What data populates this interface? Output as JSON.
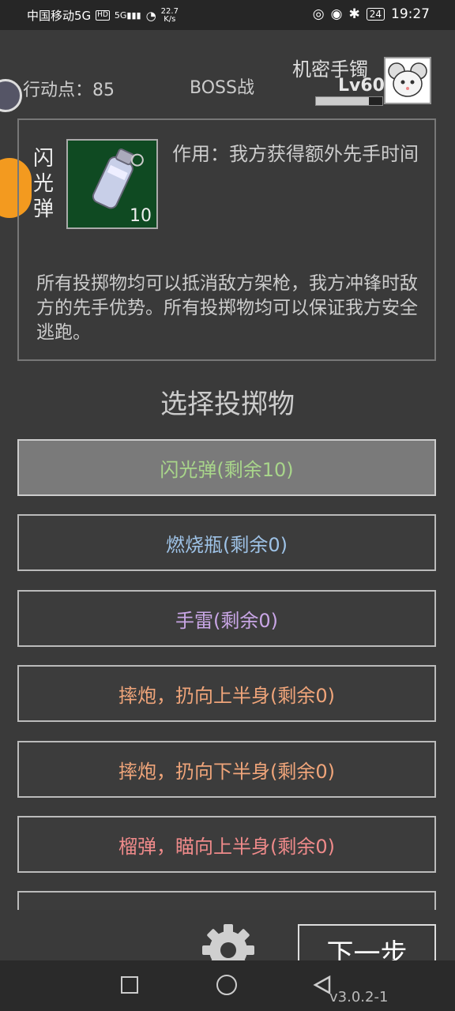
{
  "status_bar": {
    "carrier": "中国移动5G",
    "hd": "HD",
    "signal": "5G",
    "speed_top": "22.7",
    "speed_bottom": "K/s",
    "battery": "24",
    "time": "19:27"
  },
  "header": {
    "action_points": "行动点：85",
    "mode": "BOSS战",
    "item_name": "机密手镯",
    "level": "Lv60",
    "xp_fraction": 0.8
  },
  "item": {
    "name": "闪光弹",
    "count": "10",
    "effect": "作用：我方获得额外先手时间",
    "description": "所有投掷物均可以抵消敌方架枪，我方冲锋时敌方的先手优势。所有投掷物均可以保证我方安全逃跑。"
  },
  "select_title": "选择投掷物",
  "options": [
    {
      "label": "闪光弹(剩余10)",
      "color": "#a8d58a"
    },
    {
      "label": "燃烧瓶(剩余0)",
      "color": "#9ec2e6"
    },
    {
      "label": "手雷(剩余0)",
      "color": "#c9a6e6"
    },
    {
      "label": "摔炮，扔向上半身(剩余0)",
      "color": "#f0a57a"
    },
    {
      "label": "摔炮，扔向下半身(剩余0)",
      "color": "#f0a57a"
    },
    {
      "label": "榴弹，瞄向上半身(剩余0)",
      "color": "#ef8a8a"
    }
  ],
  "next_button": "下一步",
  "version": "v3.0.2-1",
  "icons": {
    "settings": "gear-icon",
    "nav_back": "back-triangle-icon",
    "nav_home": "home-circle-icon",
    "nav_recent": "recent-square-icon"
  }
}
